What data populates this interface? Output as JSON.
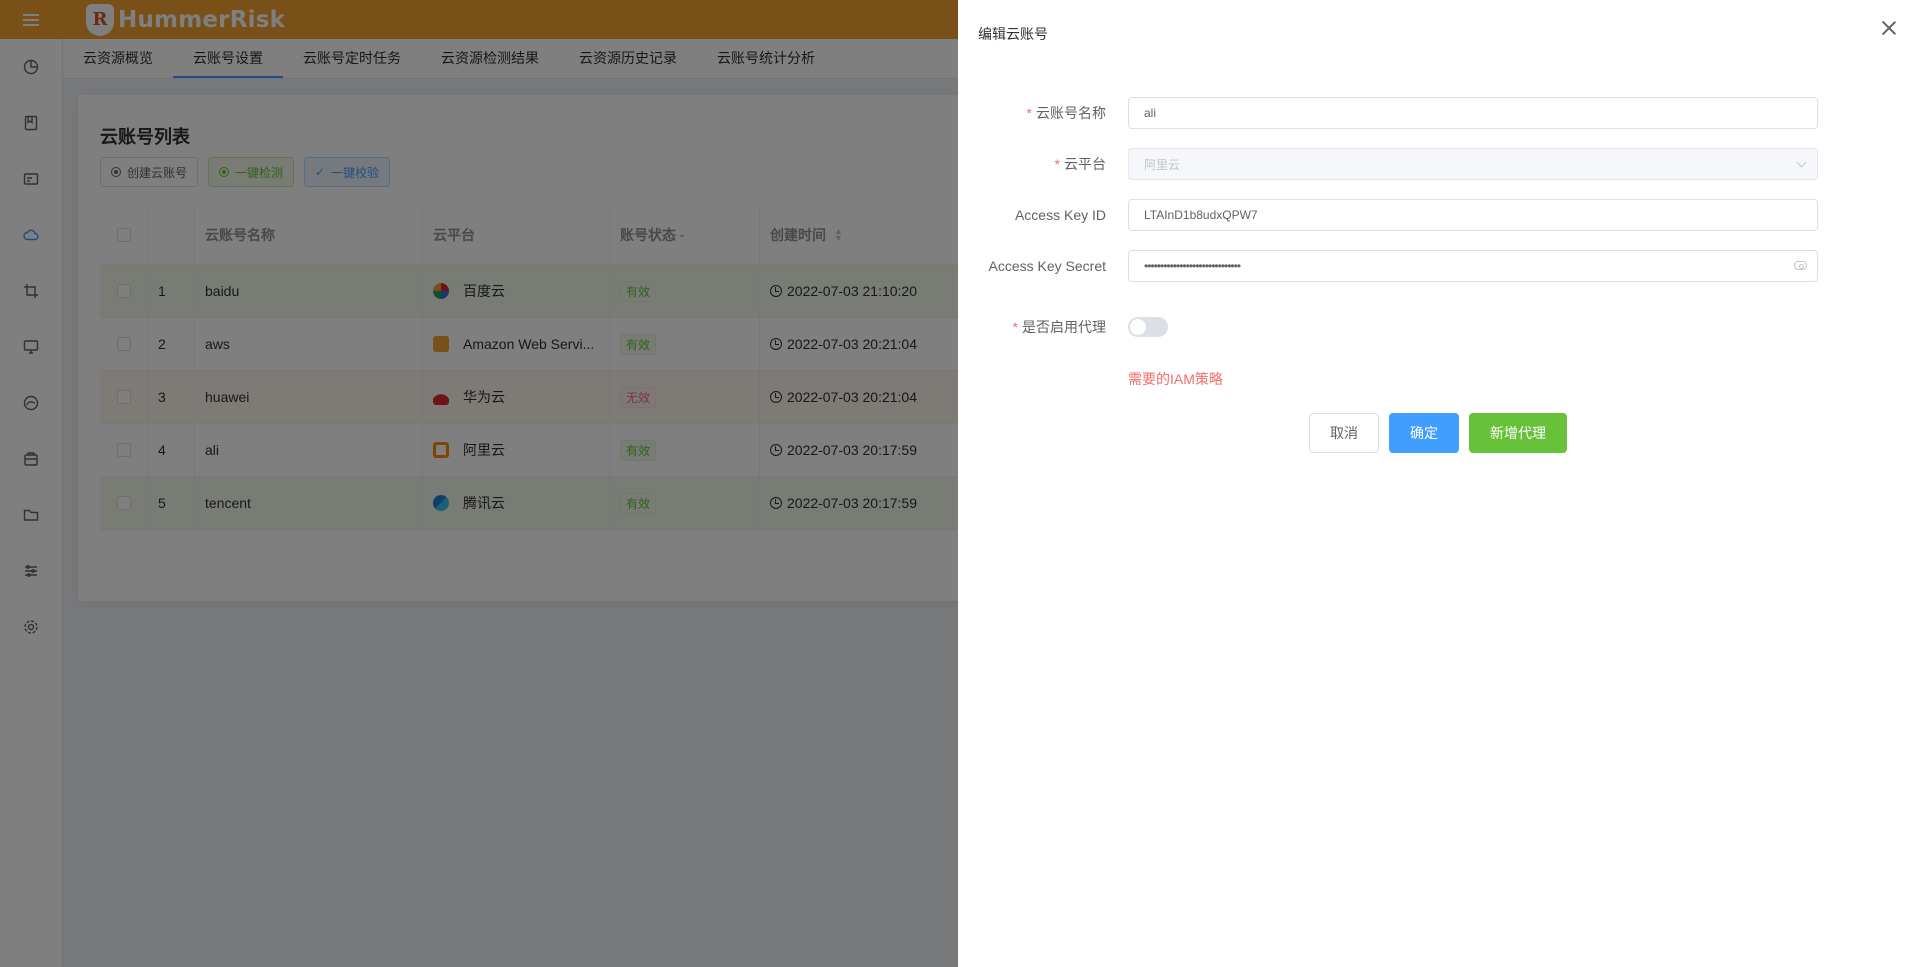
{
  "app": {
    "logo_text": "HummerRisk",
    "logo_letter": "R"
  },
  "sidebar": {
    "items": [
      {
        "icon": "pie-chart-icon"
      },
      {
        "icon": "notebook-icon"
      },
      {
        "icon": "id-card-icon"
      },
      {
        "icon": "cloud-icon",
        "active": true
      },
      {
        "icon": "crop-icon"
      },
      {
        "icon": "monitor-icon"
      },
      {
        "icon": "gauge-icon"
      },
      {
        "icon": "box-icon"
      },
      {
        "icon": "folder-icon"
      },
      {
        "icon": "sliders-icon"
      },
      {
        "icon": "gear-icon"
      }
    ]
  },
  "tabs": [
    {
      "label": "云资源概览"
    },
    {
      "label": "云账号设置",
      "active": true
    },
    {
      "label": "云账号定时任务"
    },
    {
      "label": "云资源检测结果"
    },
    {
      "label": "云资源历史记录"
    },
    {
      "label": "云账号统计分析"
    }
  ],
  "list": {
    "title": "云账号列表",
    "buttons": {
      "create": "创建云账号",
      "check": "一键检测",
      "verify": "一键校验"
    },
    "columns": {
      "name": "云账号名称",
      "platform": "云平台",
      "status": "账号状态",
      "created": "创建时间"
    },
    "rows": [
      {
        "index": "1",
        "name": "baidu",
        "platform": "百度云",
        "platform_icon": "baidu-cloud-icon",
        "platform_color": "#2f6fe4",
        "status": "有效",
        "created": "2022-07-03 21:10:20"
      },
      {
        "index": "2",
        "name": "aws",
        "platform": "Amazon Web Servi...",
        "platform_icon": "aws-icon",
        "platform_color": "#f0a030",
        "status": "有效",
        "created": "2022-07-03 20:21:04"
      },
      {
        "index": "3",
        "name": "huawei",
        "platform": "华为云",
        "platform_icon": "huawei-icon",
        "platform_color": "#e0262f",
        "status": "无效",
        "created": "2022-07-03 20:21:04"
      },
      {
        "index": "4",
        "name": "ali",
        "platform": "阿里云",
        "platform_icon": "aliyun-icon",
        "platform_color": "#ff8a00",
        "status": "有效",
        "created": "2022-07-03 20:17:59"
      },
      {
        "index": "5",
        "name": "tencent",
        "platform": "腾讯云",
        "platform_icon": "tencent-cloud-icon",
        "platform_color": "#1f7ad9",
        "status": "有效",
        "created": "2022-07-03 20:17:59"
      }
    ]
  },
  "drawer": {
    "title": "编辑云账号",
    "fields": {
      "name_label": "云账号名称",
      "name_value": "ali",
      "platform_label": "云平台",
      "platform_value": "阿里云",
      "key_id_label": "Access Key ID",
      "key_id_value": "LTAInD1b8udxQPW7",
      "key_secret_label": "Access Key Secret",
      "key_secret_value": "••••••••••••••••••••••••••••••",
      "proxy_label": "是否启用代理"
    },
    "iam_link": "需要的IAM策略",
    "buttons": {
      "cancel": "取消",
      "confirm": "确定",
      "add_proxy": "新增代理"
    }
  },
  "colors": {
    "header": "#f0a030",
    "primary": "#409eff",
    "success": "#67c23a",
    "danger": "#f56c6c"
  }
}
